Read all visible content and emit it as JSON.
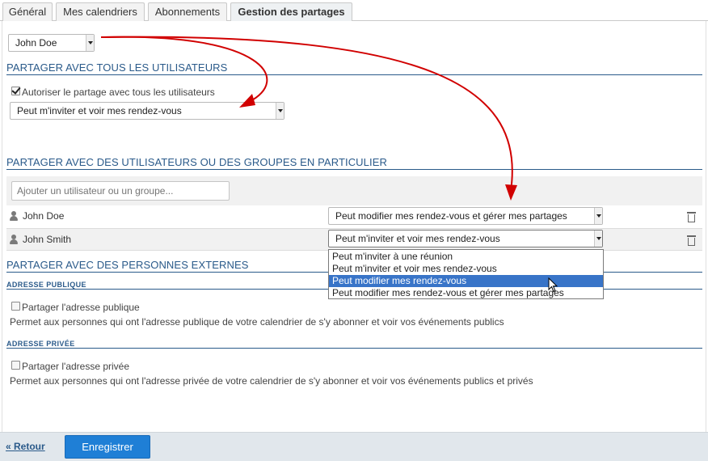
{
  "tabs": [
    {
      "label": "Général"
    },
    {
      "label": "Mes calendriers"
    },
    {
      "label": "Abonnements"
    },
    {
      "label": "Gestion des partages"
    }
  ],
  "owner_select": {
    "value": "John Doe"
  },
  "all_users": {
    "title": "PARTAGER AVEC TOUS LES UTILISATEURS",
    "checkbox_label": "Autoriser le partage avec tous les utilisateurs",
    "checked": true,
    "permission": "Peut m'inviter et voir mes rendez-vous"
  },
  "specific": {
    "title": "PARTAGER AVEC DES UTILISATEURS OU DES GROUPES EN PARTICULIER",
    "add_placeholder": "Ajouter un utilisateur ou un groupe...",
    "rows": [
      {
        "name": "John Doe",
        "permission": "Peut modifier mes rendez-vous et gérer mes partages"
      },
      {
        "name": "John Smith",
        "permission": "Peut m'inviter et voir mes rendez-vous"
      }
    ]
  },
  "dropdown_options": [
    {
      "label": "Peut m'inviter à une réunion"
    },
    {
      "label": "Peut m'inviter et voir mes rendez-vous"
    },
    {
      "label": "Peut modifier mes rendez-vous"
    },
    {
      "label": "Peut modifier mes rendez-vous et gérer mes partages"
    }
  ],
  "external": {
    "title": "PARTAGER AVEC DES PERSONNES EXTERNES",
    "public": {
      "subtitle": "ADRESSE PUBLIQUE",
      "checkbox_label": "Partager l'adresse publique",
      "description": "Permet aux personnes qui ont l'adresse publique de votre calendrier de s'y abonner et voir vos événements publics"
    },
    "private": {
      "subtitle": "ADRESSE PRIVÉE",
      "checkbox_label": "Partager l'adresse privée",
      "description": "Permet aux personnes qui ont l'adresse privée de votre calendrier de s'y abonner et voir vos événements publics et privés"
    }
  },
  "footer": {
    "back_label": "« Retour",
    "save_label": "Enregistrer"
  },
  "colors": {
    "accent": "#2a5a8a",
    "save_button": "#1f7fd6",
    "selected_option": "#3874c8",
    "annotation_arrow": "#d10000"
  }
}
